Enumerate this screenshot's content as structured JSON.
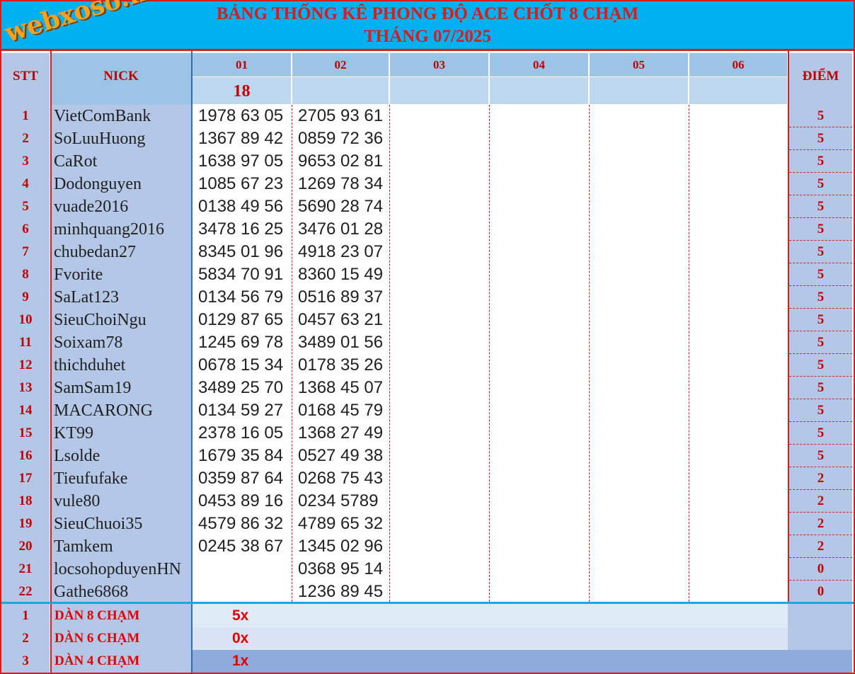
{
  "title": {
    "line1": "BẢNG THỐNG KÊ PHONG ĐỘ ACE CHỐT 8 CHẠM",
    "line2": "THÁNG 07/2025"
  },
  "watermark": "webxoso.net",
  "header": {
    "stt": "STT",
    "nick": "NICK",
    "diem": "ĐIỂM",
    "days": [
      "01",
      "02",
      "03",
      "04",
      "05",
      "06"
    ],
    "results": [
      "18",
      "",
      "",
      "",
      "",
      ""
    ]
  },
  "rows": [
    {
      "stt": "1",
      "nick": "VietComBank",
      "d1": "1978 63 05",
      "d2": "2705 93 61",
      "diem": "5"
    },
    {
      "stt": "2",
      "nick": "SoLuuHuong",
      "d1": "1367 89 42",
      "d2": "0859 72 36",
      "diem": "5"
    },
    {
      "stt": "3",
      "nick": "CaRot",
      "d1": "1638 97 05",
      "d2": "9653 02 81",
      "diem": "5"
    },
    {
      "stt": "4",
      "nick": "Dodonguyen",
      "d1": "1085 67 23",
      "d2": "1269 78 34",
      "diem": "5"
    },
    {
      "stt": "5",
      "nick": "vuade2016",
      "d1": "0138 49 56",
      "d2": "5690 28 74",
      "diem": "5"
    },
    {
      "stt": "6",
      "nick": "minhquang2016",
      "d1": "3478 16 25",
      "d2": "3476 01 28",
      "diem": "5"
    },
    {
      "stt": "7",
      "nick": "chubedan27",
      "d1": "8345 01 96",
      "d2": "4918 23 07",
      "diem": "5"
    },
    {
      "stt": "8",
      "nick": "Fvorite",
      "d1": "5834 70 91",
      "d2": "8360 15 49",
      "diem": "5"
    },
    {
      "stt": "9",
      "nick": "SaLat123",
      "d1": "0134 56 79",
      "d2": "0516 89 37",
      "diem": "5"
    },
    {
      "stt": "10",
      "nick": "SieuChoiNgu",
      "d1": "0129 87 65",
      "d2": "0457 63 21",
      "diem": "5"
    },
    {
      "stt": "11",
      "nick": "Soixam78",
      "d1": "1245 69 78",
      "d2": "3489 01 56",
      "diem": "5"
    },
    {
      "stt": "12",
      "nick": "thichduhet",
      "d1": "0678 15 34",
      "d2": "0178 35 26",
      "diem": "5"
    },
    {
      "stt": "13",
      "nick": "SamSam19",
      "d1": "3489 25 70",
      "d2": "1368 45 07",
      "diem": "5"
    },
    {
      "stt": "14",
      "nick": "MACARONG",
      "d1": "0134 59 27",
      "d2": "0168 45 79",
      "diem": "5"
    },
    {
      "stt": "15",
      "nick": "KT99",
      "d1": "2378 16 05",
      "d2": "1368 27 49",
      "diem": "5"
    },
    {
      "stt": "16",
      "nick": "Lsolde",
      "d1": "1679 35 84",
      "d2": "0527 49 38",
      "diem": "5"
    },
    {
      "stt": "17",
      "nick": "Tieufufake",
      "d1": "0359 87 64",
      "d2": "0268 75 43",
      "diem": "2"
    },
    {
      "stt": "18",
      "nick": "vule80",
      "d1": "0453 89 16",
      "d2": "0234 5789",
      "diem": "2"
    },
    {
      "stt": "19",
      "nick": "SieuChuoi35",
      "d1": "4579 86 32",
      "d2": "4789 65 32",
      "diem": "2"
    },
    {
      "stt": "20",
      "nick": "Tamkem",
      "d1": "0245 38 67",
      "d2": "1345 02 96",
      "diem": "2"
    },
    {
      "stt": "21",
      "nick": "locsohopduyenHN",
      "d1": "",
      "d2": "0368 95 14",
      "diem": "0"
    },
    {
      "stt": "22",
      "nick": "Gathe6868",
      "d1": "",
      "d2": "1236 89 45",
      "diem": "0"
    }
  ],
  "footer": [
    {
      "stt": "1",
      "label": "DÀN 8 CHẠM",
      "value": "5x"
    },
    {
      "stt": "2",
      "label": "DÀN 6 CHẠM",
      "value": "0x"
    },
    {
      "stt": "3",
      "label": "DÀN 4 CHẠM",
      "value": "1x"
    }
  ],
  "colors": {
    "title_bg": "#00b0f0",
    "accent_red": "#d81d1d",
    "header_blue": "#9dc3e6",
    "column_blue": "#b4c7e7"
  }
}
